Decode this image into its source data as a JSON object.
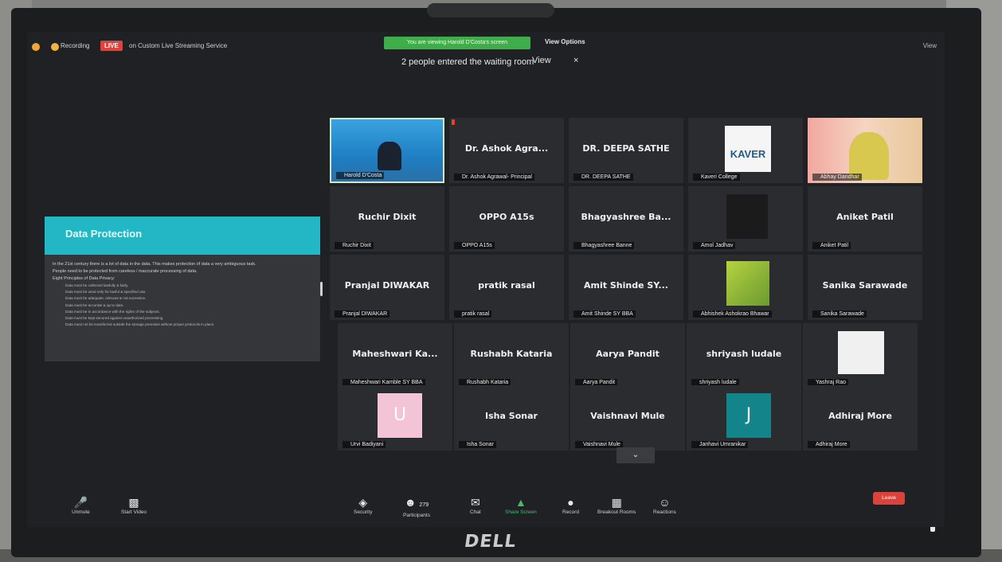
{
  "top_bar": {
    "recording_label": "Recording",
    "live_badge": "LIVE",
    "stream_label": "on Custom Live Streaming Service",
    "viewing_banner": "You are viewing Harold D'Costa's screen",
    "view_options": "View Options",
    "view_toggle": "View"
  },
  "waiting_room": {
    "message": "2 people entered the waiting room",
    "view_label": "View",
    "close_label": "×"
  },
  "slide": {
    "title": "Data Protection",
    "bullets": [
      "In the 21st century there is a lot of data in the data. This makes protection of data a very ambiguous task.",
      "People need to be protected from careless / inaccurate processing of data.",
      "Eight Principles of Data Privacy:"
    ],
    "sub_bullets": [
      "Data must be collected lawfully & fairly.",
      "Data must be used only for lawful & specified use.",
      "Data must be adequate, relevant & not excessive.",
      "Data must be accurate & up to date.",
      "Data must be in accordance with the rights of the subjects.",
      "Data must be kept secured against unauthorized processing.",
      "Data must not be transferred outside the storage premises without proper protocols in place."
    ]
  },
  "participants": [
    {
      "label": "Harold D'Costa",
      "big": ""
    },
    {
      "label": "Dr. Ashok Agrawal- Principal",
      "big": "Dr. Ashok Agra..."
    },
    {
      "label": "DR. DEEPA SATHE",
      "big": "DR. DEEPA SATHE"
    },
    {
      "label": "Kaveri College",
      "big": ""
    },
    {
      "label": "Abhay Dandhar",
      "big": ""
    },
    {
      "label": "Ruchir Dixit",
      "big": "Ruchir Dixit"
    },
    {
      "label": "OPPO A15s",
      "big": "OPPO A15s"
    },
    {
      "label": "Bhagyashree Banne",
      "big": "Bhagyashree Ba..."
    },
    {
      "label": "Amol Jadhav",
      "big": ""
    },
    {
      "label": "Aniket Patil",
      "big": "Aniket Patil"
    },
    {
      "label": "Pranjal DIWAKAR",
      "big": "Pranjal DIWAKAR"
    },
    {
      "label": "pratik rasal",
      "big": "pratik rasal"
    },
    {
      "label": "Amit Shinde SY BBA",
      "big": "Amit Shinde SY..."
    },
    {
      "label": "Abhishek Ashokrao Bhawar",
      "big": ""
    },
    {
      "label": "Sanika Sarawade",
      "big": "Sanika Sarawade"
    },
    {
      "label": "Maheshwari Kamble SY BBA",
      "big": "Maheshwari Ka..."
    },
    {
      "label": "Rushabh Kataria",
      "big": "Rushabh Kataria"
    },
    {
      "label": "Aarya Pandit",
      "big": "Aarya Pandit"
    },
    {
      "label": "shriyash ludale",
      "big": "shriyash ludale"
    },
    {
      "label": "Yashraj Rao",
      "big": ""
    },
    {
      "label": "Urvi Badiyani",
      "big": ""
    },
    {
      "label": "Isha Sonar",
      "big": "Isha Sonar"
    },
    {
      "label": "Vaishnavi Mule",
      "big": "Vaishnavi Mule"
    },
    {
      "label": "Janhavi Umranikar",
      "big": ""
    },
    {
      "label": "Adhiraj More",
      "big": "Adhiraj More"
    }
  ],
  "avatars": {
    "kaveri_logo_text": "KAVER",
    "urvi_letter": "U",
    "janhavi_letter": "J"
  },
  "toolbar": {
    "unmute": "Unmute",
    "start_video": "Start Video",
    "security": "Security",
    "participants": "Participants",
    "participant_count": "279",
    "chat": "Chat",
    "share_screen": "Share Screen",
    "record": "Record",
    "breakout_rooms": "Breakout Rooms",
    "reactions": "Reactions",
    "end": "Leave"
  },
  "monitor": {
    "brand": "DELL"
  },
  "colors": {
    "live_red": "#e0423a",
    "banner_green": "#3fae4a",
    "slide_teal": "#23b6c4",
    "tile_bg": "#2a2c30"
  }
}
